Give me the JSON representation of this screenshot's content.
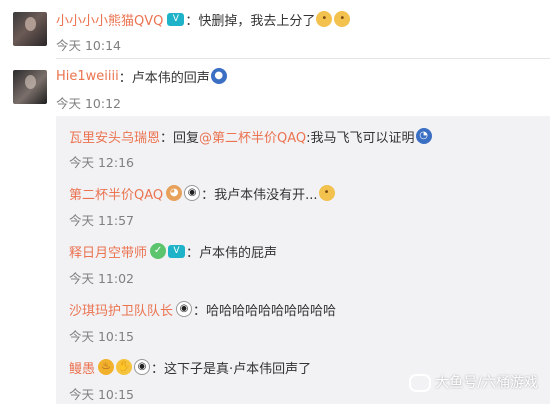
{
  "comments": [
    {
      "username": "小小小小熊猫QVQ",
      "text": "：快删掉，我去上分了",
      "time": "今天 10:14"
    },
    {
      "username": "Hie1weiiii",
      "text": "：卢本伟的回声",
      "time": "今天 10:12"
    }
  ],
  "replies": [
    {
      "username": "瓦里安头乌瑞恩",
      "prefix": "：回复",
      "mention": "@第二杯半价QAQ",
      "text": ":我马飞飞可以证明",
      "time": "今天 12:16"
    },
    {
      "username": "第二杯半价QAQ",
      "text": "：我卢本伟没有开...",
      "time": "今天 11:57"
    },
    {
      "username": "释日月空带师",
      "text": "：卢本伟的屁声",
      "time": "今天 11:02"
    },
    {
      "username": "沙琪玛护卫队队长",
      "text": "：哈哈哈哈哈哈哈哈哈哈",
      "time": "今天 10:15"
    },
    {
      "username": "鳗愚",
      "text": "：这下子是真·卢本伟回声了",
      "time": "今天 10:15"
    }
  ],
  "watermark": "大鱼号/六桶游戏",
  "icons": {
    "vip": "vip-badge-icon",
    "doge": "doge-emoji-icon",
    "panda": "panda-icon",
    "green": "green-badge-icon",
    "cry": "crying-emoji-icon",
    "sonic": "sonic-emoji-icon",
    "hand": "hand-emoji-icon",
    "cup": "cup-icon"
  },
  "colors": {
    "username": "#eb7350",
    "reply_background": "#f2f2f5",
    "time": "#808080"
  }
}
